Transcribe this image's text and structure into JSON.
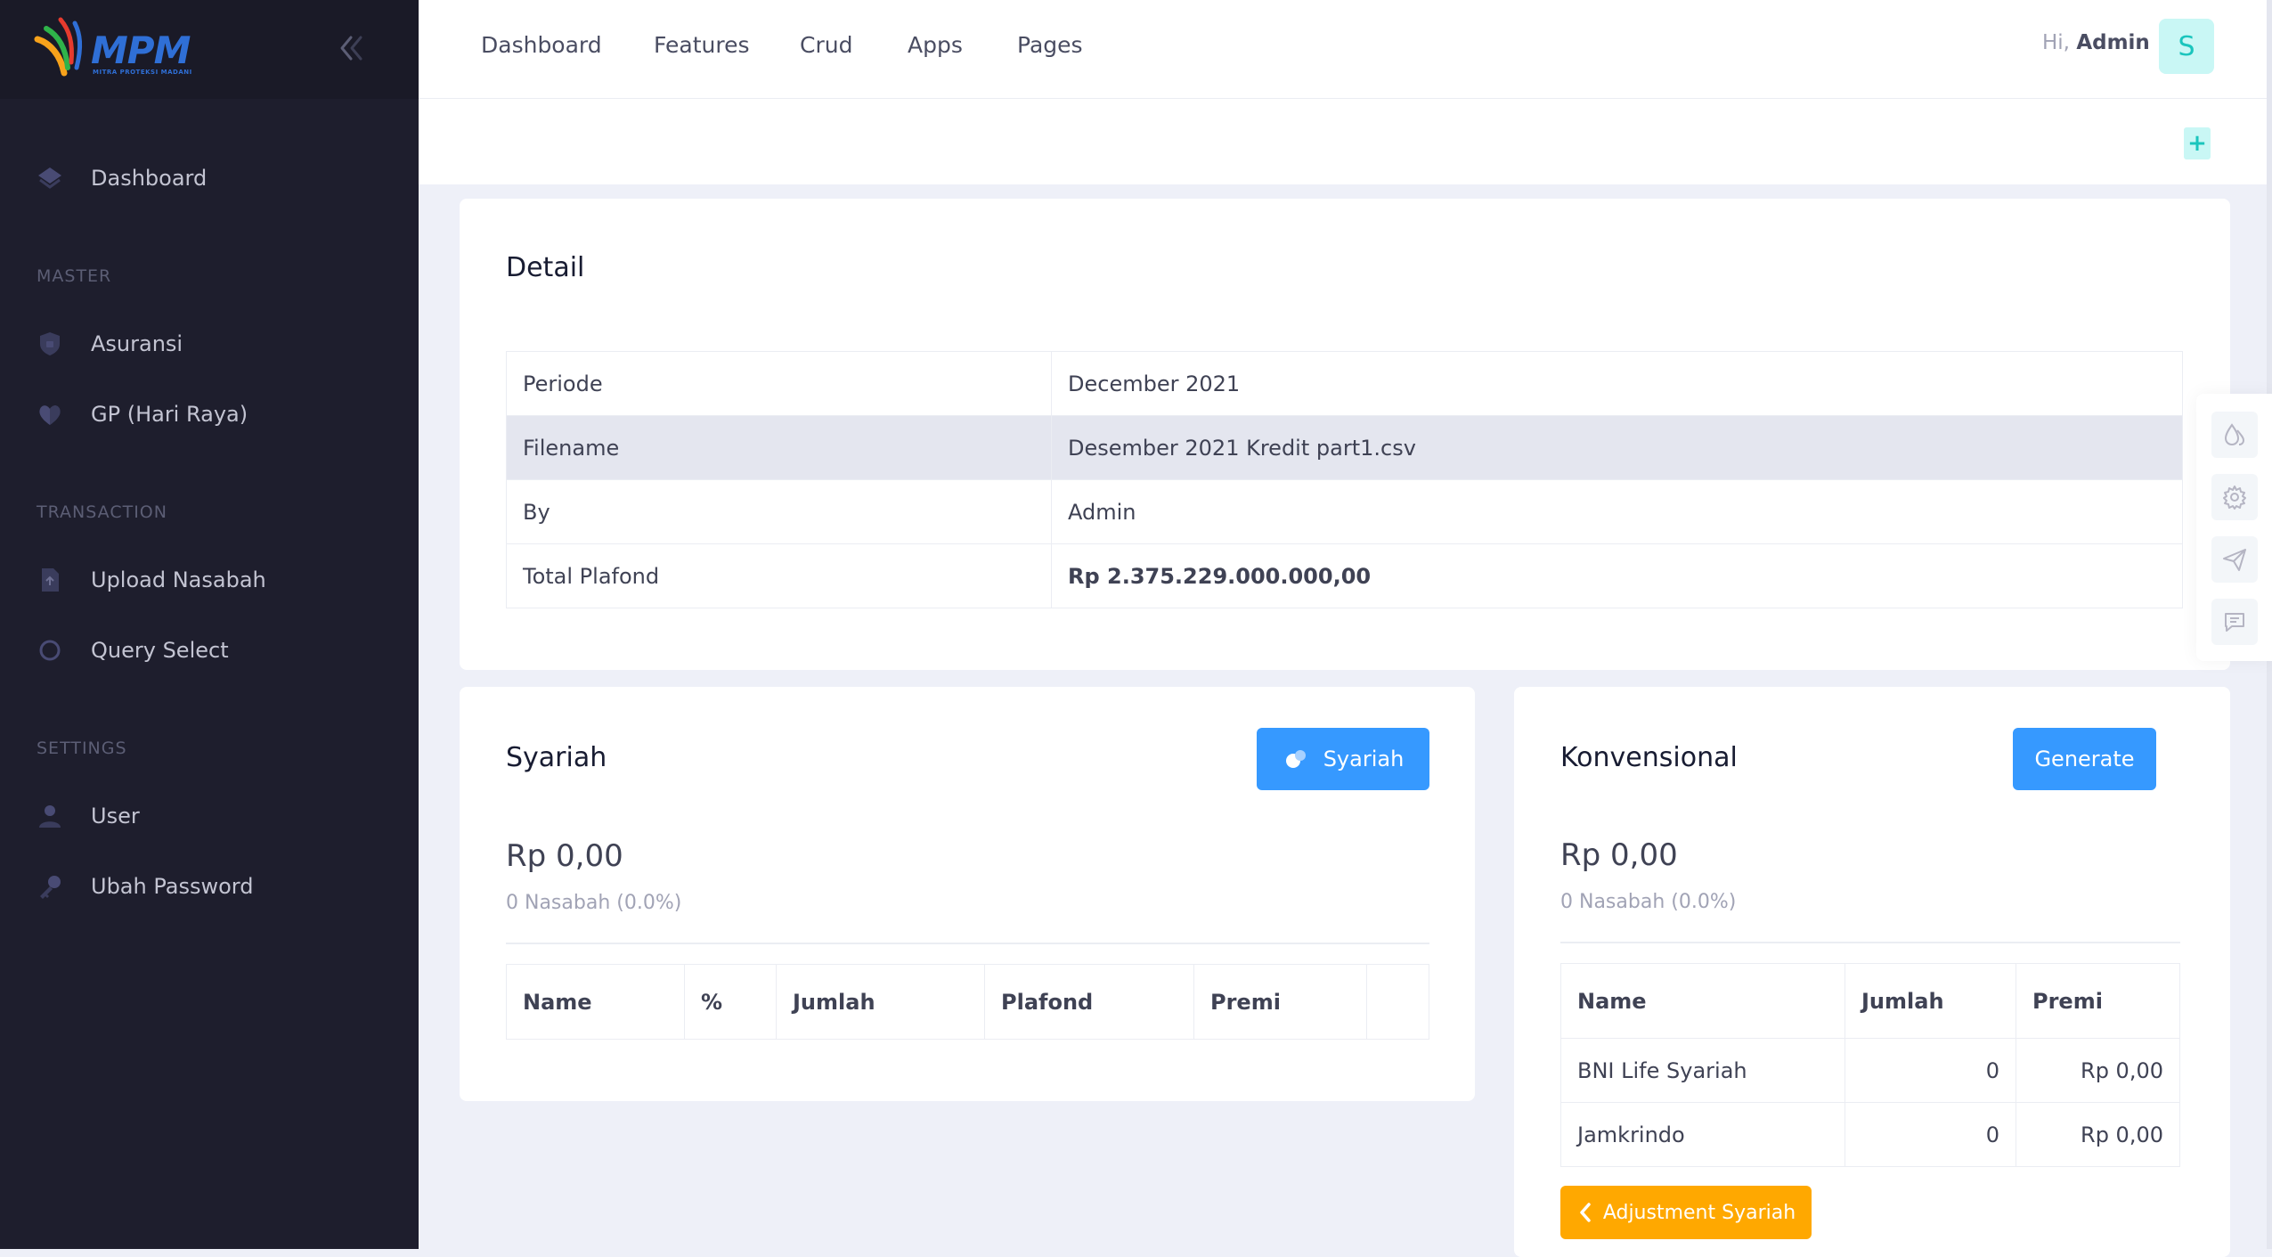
{
  "brand": {
    "logo_text": "MPM",
    "logo_sub": "MITRA PROTEKSI MADANI"
  },
  "sidebar": {
    "dashboard": "Dashboard",
    "section_master": "MASTER",
    "asuransi": "Asuransi",
    "gp": "GP (Hari Raya)",
    "section_transaction": "TRANSACTION",
    "upload": "Upload Nasabah",
    "query": "Query Select",
    "section_settings": "SETTINGS",
    "user": "User",
    "ubah_password": "Ubah Password"
  },
  "header": {
    "nav": [
      "Dashboard",
      "Features",
      "Crud",
      "Apps",
      "Pages"
    ],
    "greeting": "Hi,",
    "username": "Admin",
    "avatar_initial": "S"
  },
  "subheader": {
    "plus": "+"
  },
  "detail": {
    "title": "Detail",
    "rows": [
      {
        "label": "Periode",
        "value": "December 2021"
      },
      {
        "label": "Filename",
        "value": "Desember 2021 Kredit part1.csv"
      },
      {
        "label": "By",
        "value": "Admin"
      },
      {
        "label": "Total Plafond",
        "value": "Rp 2.375.229.000.000,00"
      }
    ]
  },
  "syariah": {
    "title": "Syariah",
    "button": "Syariah",
    "amount": "Rp 0,00",
    "nasabah": "0 Nasabah (0.0%)",
    "columns": [
      "Name",
      "%",
      "Jumlah",
      "Plafond",
      "Premi",
      ""
    ]
  },
  "konvensional": {
    "title": "Konvensional",
    "button": "Generate",
    "amount": "Rp 0,00",
    "nasabah": "0 Nasabah (0.0%)",
    "columns": [
      "Name",
      "Jumlah",
      "Premi"
    ],
    "rows": [
      {
        "name": "BNI Life Syariah",
        "jumlah": "0",
        "premi": "Rp 0,00"
      },
      {
        "name": "Jamkrindo",
        "jumlah": "0",
        "premi": "Rp 0,00"
      }
    ],
    "adjust_button": "Adjustment Syariah"
  },
  "colors": {
    "primary": "#3699ff",
    "warning": "#ffa800",
    "sidebar": "#1e1e2d",
    "accent_teal": "#1bc5bd"
  }
}
